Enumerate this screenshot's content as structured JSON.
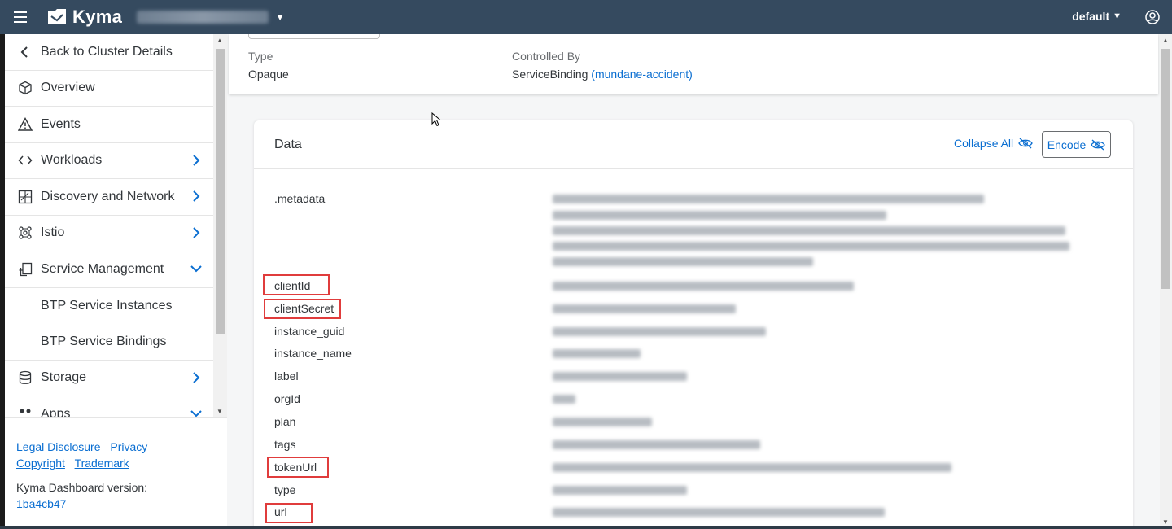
{
  "shell": {
    "brand": "Kyma",
    "namespace": "default"
  },
  "sidebar": {
    "back_label": "Back to Cluster Details",
    "items": [
      {
        "label": "Overview"
      },
      {
        "label": "Events"
      },
      {
        "label": "Workloads"
      },
      {
        "label": "Discovery and Network"
      },
      {
        "label": "Istio"
      },
      {
        "label": "Service Management"
      },
      {
        "label": "BTP Service Instances"
      },
      {
        "label": "BTP Service Bindings"
      },
      {
        "label": "Storage"
      },
      {
        "label": "Apps"
      }
    ],
    "footer": {
      "legal": "Legal Disclosure",
      "privacy": "Privacy",
      "copyright": "Copyright",
      "trademark": "Trademark",
      "version_label": "Kyma Dashboard version:",
      "version_link": "1ba4cb47"
    }
  },
  "meta": {
    "type_label": "Type",
    "type_value": "Opaque",
    "controlled_label": "Controlled By",
    "controlled_value": "ServiceBinding",
    "controlled_link": "(mundane-accident)"
  },
  "data_card": {
    "title": "Data",
    "collapse_label": "Collapse All",
    "encode_label": "Encode",
    "keys": [
      ".metadata",
      "clientId",
      "clientSecret",
      "instance_guid",
      "instance_name",
      "label",
      "orgId",
      "plan",
      "tags",
      "tokenUrl",
      "type",
      "url"
    ],
    "highlighted_keys": [
      "clientId",
      "clientSecret",
      "tokenUrl",
      "url"
    ],
    "highlight_color": "#e03c3c"
  },
  "colors": {
    "shell": "#354a5f",
    "link": "#0a6ed1"
  }
}
